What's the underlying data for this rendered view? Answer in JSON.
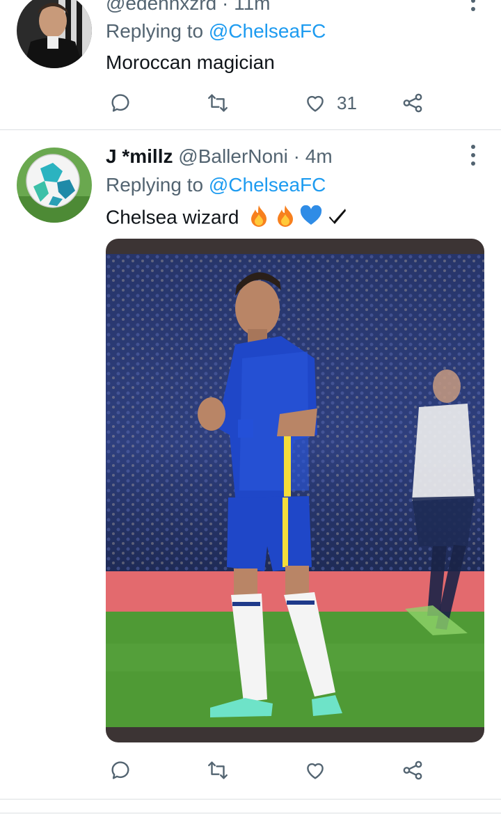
{
  "tweets": [
    {
      "handle": "@edennxzrd",
      "time": "· 11m",
      "replying_prefix": "Replying to",
      "replying_to": "@ChelseaFC",
      "text": "Moroccan magician",
      "actions": {
        "reply_count": "",
        "retweet_count": "",
        "like_count": "31"
      }
    },
    {
      "name": "J *millz",
      "handle": "@BallerNoni",
      "time": "· 4m",
      "replying_prefix": "Replying to",
      "replying_to": "@ChelseaFC",
      "text": "Chelsea wizard",
      "emojis": [
        "fire-emoji",
        "fire-emoji",
        "blue-heart-emoji",
        "check-mark-emoji"
      ],
      "media": "photo",
      "actions": {
        "reply_count": "",
        "retweet_count": "",
        "like_count": ""
      }
    }
  ],
  "colors": {
    "link": "#1d9bf0",
    "secondary": "#536471",
    "text": "#0f1419",
    "divider": "#dcdfe2"
  },
  "icons": [
    "more-icon",
    "reply-icon",
    "retweet-icon",
    "like-icon",
    "share-icon"
  ]
}
